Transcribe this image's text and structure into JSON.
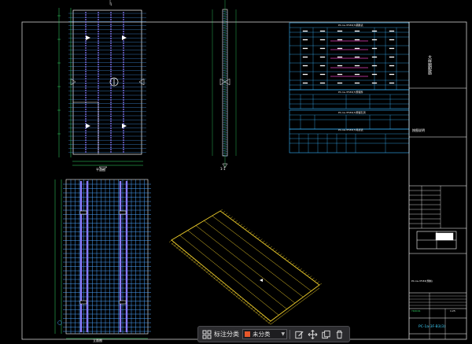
{
  "drawing": {
    "colors": {
      "background": "#000000",
      "frame": "#ffffff",
      "primary_line": "#ffffff",
      "grid": "#4aa3ff",
      "rebar": "#8a7bff",
      "dimension": "#35e06b",
      "table_line": "#38b6ff",
      "magenta": "#e040c0",
      "iso_slab": "#f2d02a"
    },
    "top_marker": "1",
    "section_marker": "1-1",
    "plan_title": "平面图",
    "elevation_label": "立面图",
    "title_block": {
      "side_text": "大样图配筋",
      "note_text": "按图说明",
      "sheet_code": "PC-1a-3F-B3(3)",
      "drawing_code": "PC-1a-3F-B3(预制)",
      "scale_label": "1:25",
      "proj_no": "YKXC01"
    },
    "tables": {
      "title1": "PC-1a-3F-B3(3)钢筋表",
      "title2": "PC-1a-3F-B3(3)预埋件",
      "title3": "PC-1a-3F-B3(3)预留孔洞",
      "title4": "PC-1a-3F-B3(3)吊点表"
    }
  },
  "toolbar": {
    "grid_icon": "grid-icon",
    "label": "标注分类",
    "select_value": "未分类",
    "swatch_color": "#e8572a",
    "actions": [
      "edit-icon",
      "move-icon",
      "copy-icon",
      "delete-icon"
    ]
  }
}
